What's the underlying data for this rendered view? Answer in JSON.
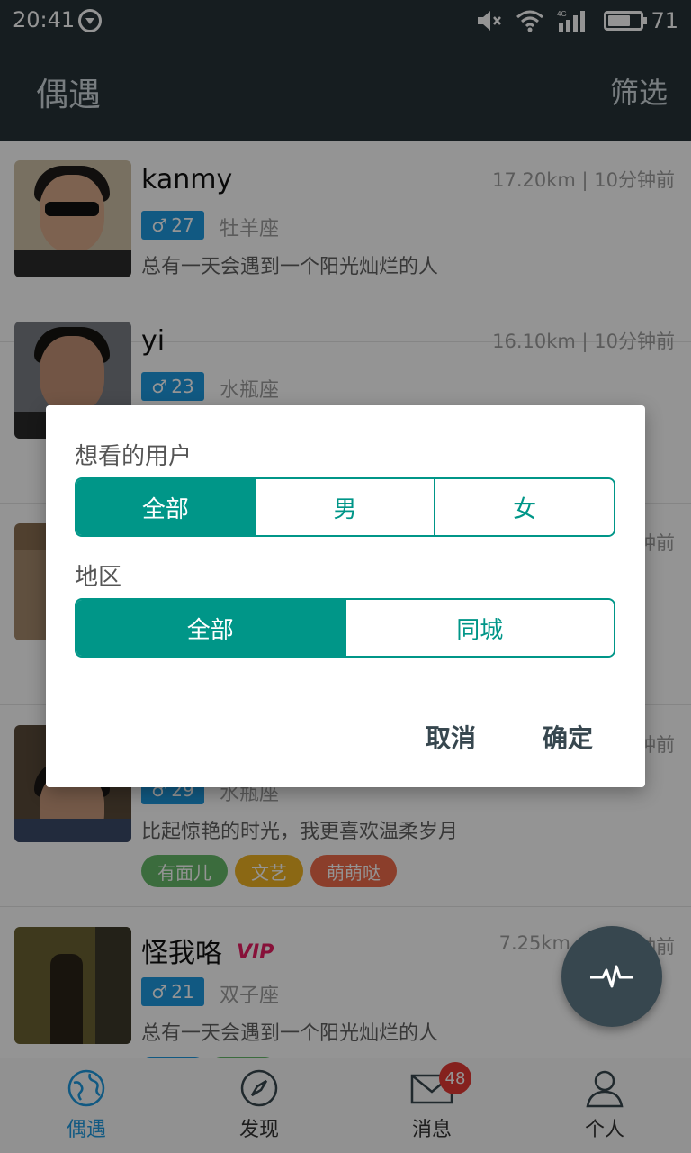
{
  "status": {
    "time": "20:41",
    "battery": "71",
    "network": "4G"
  },
  "header": {
    "title": "偶遇",
    "filter": "筛选"
  },
  "list": [
    {
      "name": "kanmy",
      "meta": "17.20km | 10分钟前",
      "age": "27",
      "zodiac": "牡羊座",
      "bio": "总有一天会遇到一个阳光灿烂的人"
    },
    {
      "name": "yi",
      "meta": "16.10km | 10分钟前",
      "age": "23",
      "zodiac": "水瓶座",
      "bio": ""
    },
    {
      "name": "",
      "meta": "钟前",
      "age": "",
      "zodiac": "",
      "bio": ""
    },
    {
      "name": "",
      "meta": "钟前",
      "age": "29",
      "zodiac": "水瓶座",
      "bio": "比起惊艳的时光，我更喜欢温柔岁月",
      "tags": [
        "有面儿",
        "文艺",
        "萌萌哒"
      ]
    },
    {
      "name": "怪我咯",
      "vip": "VIP",
      "meta": "7.25km",
      "meta2": "钟前",
      "age": "21",
      "zodiac": "双子座",
      "bio": "总有一天会遇到一个阳光灿烂的人"
    }
  ],
  "dialog": {
    "gender_label": "想看的用户",
    "gender_options": [
      "全部",
      "男",
      "女"
    ],
    "region_label": "地区",
    "region_options": [
      "全部",
      "同城"
    ],
    "cancel": "取消",
    "confirm": "确定"
  },
  "nav": [
    {
      "label": "偶遇",
      "icon": "globe-icon"
    },
    {
      "label": "发现",
      "icon": "compass-icon"
    },
    {
      "label": "消息",
      "icon": "mail-icon",
      "badge": "48"
    },
    {
      "label": "个人",
      "icon": "person-icon"
    }
  ],
  "colors": {
    "accent": "#009688",
    "header": "#263238",
    "badge_blue": "#1e9ae0",
    "vip": "#e91e63"
  }
}
